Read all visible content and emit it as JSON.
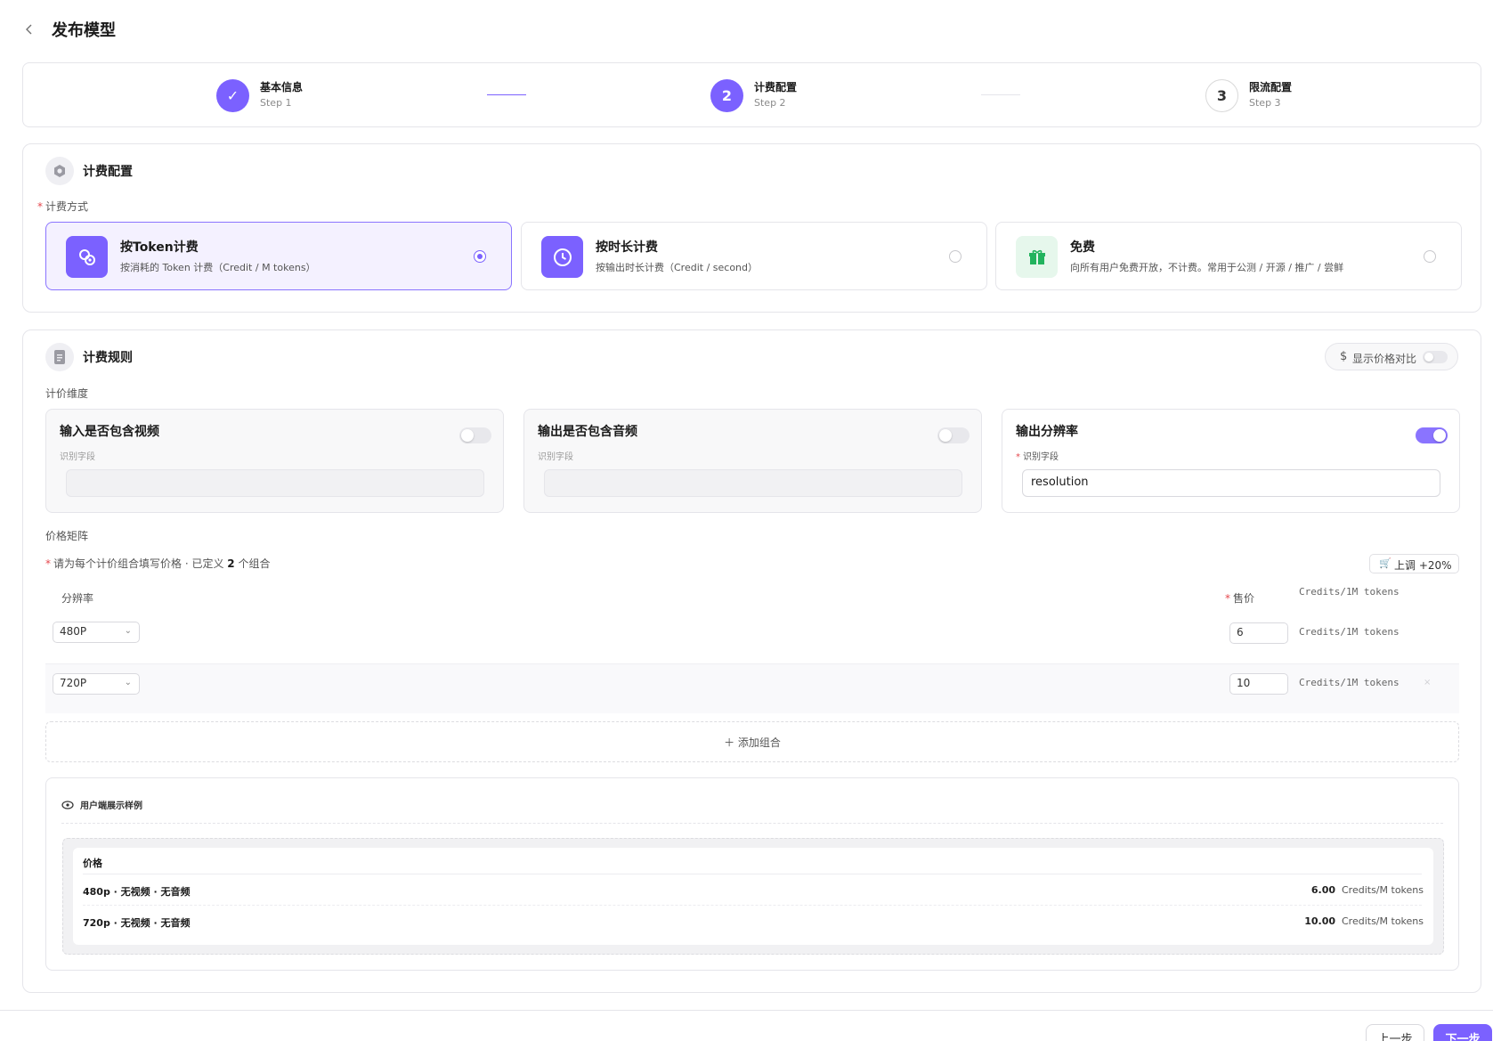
{
  "header": {
    "title": "发布模型"
  },
  "steps": [
    {
      "title": "基本信息",
      "sub": "Step 1",
      "marker": "✓",
      "state": "done"
    },
    {
      "title": "计费配置",
      "sub": "Step 2",
      "marker": "2",
      "state": "active"
    },
    {
      "title": "限流配置",
      "sub": "Step 3",
      "marker": "3",
      "state": "todo"
    }
  ],
  "billing": {
    "section_title": "计费配置",
    "method_label": "计费方式",
    "options": [
      {
        "title": "按Token计费",
        "desc": "按消耗的 Token 计费（Credit / M tokens）",
        "icon": "token-icon",
        "selected": true
      },
      {
        "title": "按时长计费",
        "desc": "按输出时长计费（Credit / second）",
        "icon": "clock-icon",
        "selected": false
      },
      {
        "title": "免费",
        "desc": "向所有用户免费开放，不计费。常用于公测 / 开源 / 推广 / 尝鲜",
        "icon": "gift-icon",
        "selected": false
      }
    ]
  },
  "rules": {
    "section_title": "计费规则",
    "compare_label": "显示价格对比",
    "compare_on": false,
    "dimension_label": "计价维度",
    "dimensions": [
      {
        "title": "输入是否包含视频",
        "field_label": "识别字段",
        "value": "",
        "enabled": false,
        "required": false
      },
      {
        "title": "输出是否包含音频",
        "field_label": "识别字段",
        "value": "",
        "enabled": false,
        "required": false
      },
      {
        "title": "输出分辨率",
        "field_label": "识别字段",
        "value": "resolution",
        "enabled": true,
        "required": true
      }
    ],
    "matrix_label": "价格矩阵",
    "matrix_hint_prefix": "请为每个计价组合填写价格 · 已定义 ",
    "matrix_hint_count": "2",
    "matrix_hint_suffix": " 个组合",
    "adjust_button": "上调 +20%",
    "col_resolution": "分辨率",
    "col_price": "售价",
    "col_unit": "Credits/1M tokens",
    "rows": [
      {
        "resolution": "480P",
        "price": "6",
        "unit": "Credits/1M tokens"
      },
      {
        "resolution": "720P",
        "price": "10",
        "unit": "Credits/1M tokens"
      }
    ],
    "add_combo": "添加组合"
  },
  "preview": {
    "title": "用户端展示样例",
    "header": "价格",
    "rows": [
      {
        "label": "480p · 无视频 · 无音频",
        "value": "6.00",
        "unit": "Credits/M tokens"
      },
      {
        "label": "720p · 无视频 · 无音频",
        "value": "10.00",
        "unit": "Credits/M tokens"
      }
    ]
  },
  "footer": {
    "prev": "上一步",
    "next": "下一步"
  },
  "colors": {
    "accent": "#7b61ff",
    "accent_light": "#f4f1ff",
    "gift_green": "#22b35e"
  }
}
